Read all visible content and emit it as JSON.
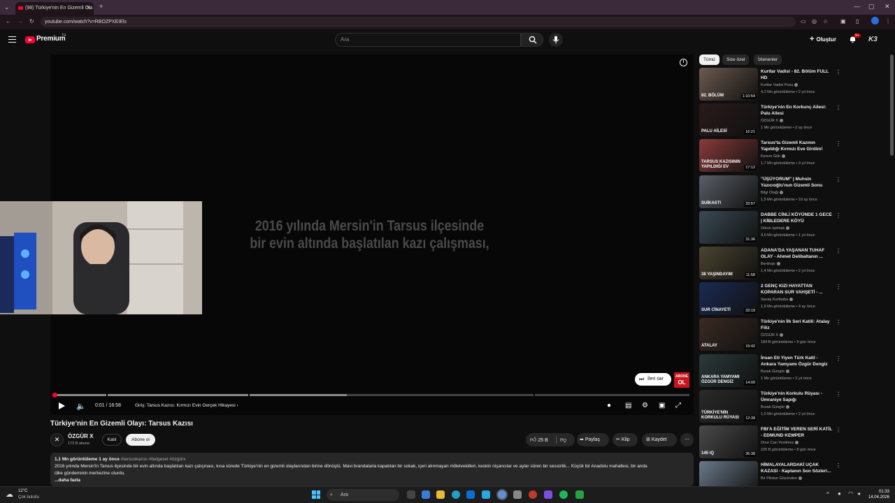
{
  "browser": {
    "tab_title": "(98) Türkiye'nin En Gizemli Ola",
    "url": "youtube.com/watch?v=RBOZPXEIEls"
  },
  "header": {
    "brand": "Premium",
    "country": "TR",
    "search_placeholder": "Ara",
    "create_label": "Oluştur",
    "notifications": "9+"
  },
  "player": {
    "subtitle_line1": "2016 yılında Mersin'in Tarsus ilçesinde",
    "subtitle_line2": "bir evin altında başlatılan kazı çalışması,",
    "skip_label": "İleri sar",
    "abone_line1": "ABONE",
    "abone_line2": "OL",
    "time": "0:01 / 16:58",
    "chapter": "Giriş: Tarsus Kazısı: Kırmızı Evin Gerçek Hikayesi",
    "progress_played": 0.001,
    "progress_buffered": 0.46
  },
  "video": {
    "title": "Türkiye'nin En Gizemli Olayı: Tarsus Kazısı",
    "channel": "ÖZGÜR X",
    "subscribers": "173 B abone",
    "join_label": "Katıl",
    "subscribe_label": "Abone ol",
    "likes": "25 B",
    "share_label": "Paylaş",
    "clip_label": "Klip",
    "save_label": "Kaydet",
    "views_time": "1,1 Mn görüntüleme  1 ay önce",
    "hashtags": "#tarsuskazısı #belgesel #özgürx",
    "description_line1": "2016 yılında Mersin'in Tarsus ilçesinde bir evin altında başlatılan kazı çalışması, kısa sürede Türkiye'nin en gizemli olaylarından birine dönüştü. Mavi brandalarla kapatılan bir sokak, içeri alınmayan milletvekilleri, keskin nişancılar ve aylar süren bir sessizlik... Küçük bir Anadolu mahallesi, bir anda",
    "description_line2": "ülke gündeminin merkezine oturdu.",
    "more_label": "...daha fazla"
  },
  "sidebar": {
    "chips": [
      "Tümü",
      "Size özel",
      "İzlenenler"
    ],
    "recommendations": [
      {
        "title": "Kurtlar Vadisi - 82. Bölüm FULL HD",
        "channel": "Kurtlar Vadisi Pusu",
        "meta": "4,2 Mn görüntüleme • 2 yıl önce",
        "duration": "1:10:54",
        "thumb_color": "#6b5a4e",
        "thumb_text": "82. BÖLÜM"
      },
      {
        "title": "Türkiye'nin En Korkunç Ailesi: Palu Ailesi",
        "channel": "ÖZGÜR X",
        "meta": "1 Mn görüntüleme • 2 ay önce",
        "duration": "16:21",
        "thumb_color": "#2a1a1a",
        "thumb_text": "PALU AİLESİ"
      },
      {
        "title": "Tarsus'ta Gizemli Kazının Yapıldığı Kırmızı Eve Girdim!",
        "channel": "Kerem Gök",
        "meta": "1,7 Mn görüntüleme • 3 yıl önce",
        "duration": "17:12",
        "thumb_color": "#8a3a3a",
        "thumb_text": "TARSUS KAZISININ YAPILDIĞI EV"
      },
      {
        "title": "\"ÜŞÜYORUM\" | Muhsin Yazıcıoğlu'nun Gizemli Sonu",
        "channel": "Bilgi Otağı",
        "meta": "1,5 Mn görüntüleme • 10 ay önce",
        "duration": "33:57",
        "thumb_color": "#5a5f66",
        "thumb_text": "SUİKASTI"
      },
      {
        "title": "DABBE CİNLİ KÖYÜNDE 1 GECE | KİBLEDERE KÖYÜ",
        "channel": "Orkun Işıtmak",
        "meta": "4,6 Mn görüntüleme • 1 yıl önce",
        "duration": "31:36",
        "thumb_color": "#3a4a55",
        "thumb_text": ""
      },
      {
        "title": "ADANA'DA YAŞANAN TUHAF OLAY - Ahmet Delibaltanın ...",
        "channel": "Bentropi",
        "meta": "1,4 Mn görüntüleme • 2 yıl önce",
        "duration": "11:58",
        "thumb_color": "#4a4430",
        "thumb_text": "38 YAŞINDAYIM"
      },
      {
        "title": "2 GENÇ KIZI HAYATTAN KOPARAN SUR VAHŞETİ - ...",
        "channel": "Savaş Kurtbaba",
        "meta": "1,9 Mn görüntüleme • 4 ay önce",
        "duration": "33:19",
        "thumb_color": "#1a2a55",
        "thumb_text": "SUR CİNAYETİ"
      },
      {
        "title": "Türkiye'nin İlk Seri Katili: Atalay Filiz",
        "channel": "ÖZGÜR X",
        "meta": "184 B görüntüleme • 9 gün önce",
        "duration": "19:42",
        "thumb_color": "#3a2a22",
        "thumb_text": "ATALAY"
      },
      {
        "title": "İnsan Eti Yiyen Türk Katil - Ankara Yamyamı Özgür Dengiz",
        "channel": "Burak Güngör",
        "meta": "1 Mn görüntüleme • 2 yıl önce",
        "duration": "14:00",
        "thumb_color": "#2a3a3a",
        "thumb_text": "ANKARA YAMYAMI ÖZGÜR DENGİZ"
      },
      {
        "title": "Türkiye'nin Korkulu Rüyası - Ümraniye Sapığı",
        "channel": "Burak Güngör",
        "meta": "1,5 Mn görüntüleme • 2 yıl önce",
        "duration": "12:39",
        "thumb_color": "#2a2a2a",
        "thumb_text": "TÜRKİYE'NİN KORKULU RÜYASI"
      },
      {
        "title": "FBI'A EĞİTİM VEREN SERİ KATİL - EDMUND KEMPER",
        "channel": "Onur Can Yenilmez",
        "meta": "226 B görüntüleme • 8 gün önce",
        "duration": "36:38",
        "thumb_color": "#4a4a4a",
        "thumb_text": "145 IQ"
      },
      {
        "title": "HİMALAYALARDAKİ UÇAK KAZASI - Kaptanın Son Sözleri...",
        "channel": "Bir Pilotun Gözünden",
        "meta": "",
        "duration": "",
        "thumb_color": "#6a7a8a",
        "thumb_text": ""
      }
    ]
  },
  "taskbar": {
    "temperature": "12°C",
    "weather": "Çok bulutlu",
    "search_label": "Ara",
    "time": "01:33",
    "date": "14.04.2026"
  }
}
